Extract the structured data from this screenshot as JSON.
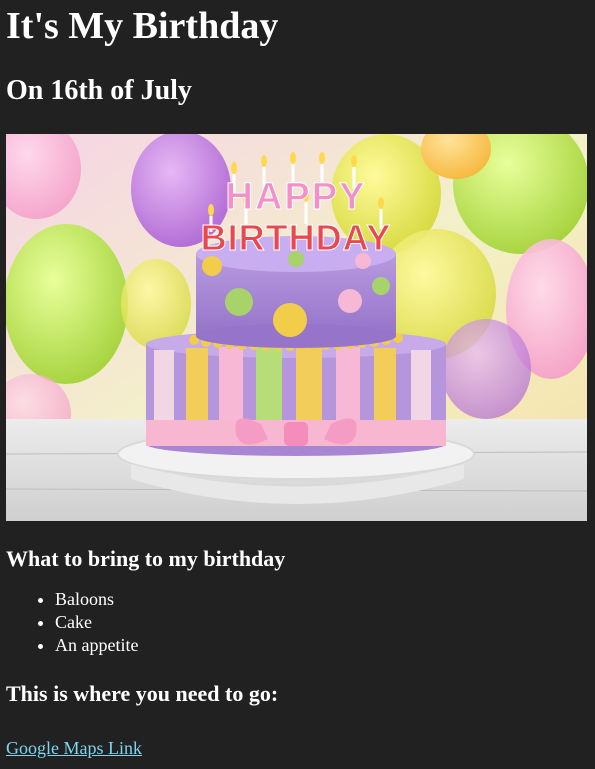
{
  "page": {
    "title": "It's My Birthday",
    "subtitle": "On 16th of July",
    "image_alt": "Birthday cake with Happy Birthday candles and balloons",
    "cake_topper_line1": "HAPPY",
    "cake_topper_line2": "BIRTHDAY",
    "bring_heading": "What to bring to my birthday",
    "bring_items": [
      "Baloons",
      "Cake",
      "An appetite"
    ],
    "directions_heading": "This is where you need to go:",
    "map_link_label": "Google Maps Link"
  },
  "colors": {
    "background": "#212121",
    "text": "#ffffff",
    "link": "#7fd4f0"
  }
}
